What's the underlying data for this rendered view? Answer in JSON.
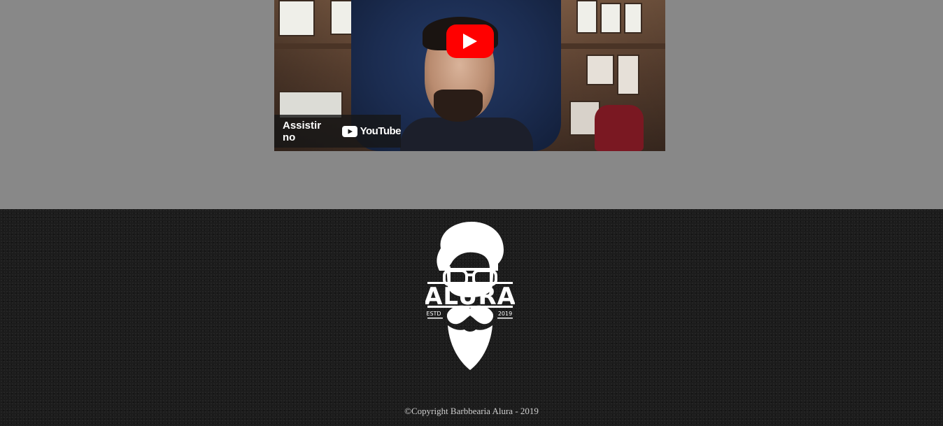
{
  "video": {
    "watch_on_label": "Assistir no",
    "youtube_wordmark": "YouTube",
    "play_icon": "play-icon",
    "youtube_color": "#ff0000"
  },
  "footer": {
    "logo": {
      "brand": "ALURA",
      "estd_label": "ESTD",
      "year": "2019"
    },
    "copyright": "©Copyright Barbbearia Alura - 2019"
  },
  "colors": {
    "page_background": "#888888",
    "footer_background": "#1c1c1c",
    "logo_color": "#ffffff"
  }
}
